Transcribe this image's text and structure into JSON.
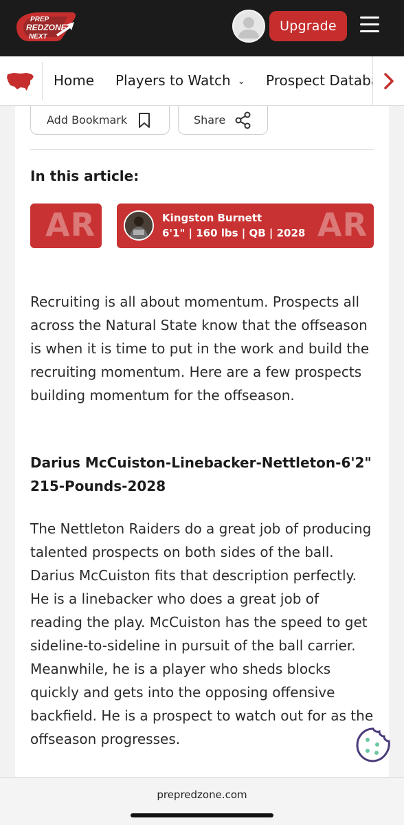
{
  "header": {
    "logo_text": [
      "PREP",
      "REDZONE",
      "NEXT"
    ],
    "upgrade_label": "Upgrade",
    "brand_color": "#c62e2e"
  },
  "nav": {
    "items": [
      {
        "label": "Home"
      },
      {
        "label": "Players to Watch",
        "has_dropdown": true
      },
      {
        "label": "Prospect Database"
      }
    ],
    "map_icon": "us-map-icon",
    "next_icon": "chevron-right-icon"
  },
  "actions": {
    "bookmark_label": "Add Bookmark",
    "share_label": "Share"
  },
  "article": {
    "in_article_label": "In this article:",
    "players": [
      {
        "watermark": "AR"
      },
      {
        "name": "Kingston Burnett",
        "meta": "6'1\" | 160 lbs | QB | 2028",
        "watermark": "AR"
      }
    ],
    "intro": "Recruiting is all about momentum. Prospects all across the Natural State know that the offseason is when it is time to put in the work and build the recruiting momentum. Here are a few prospects building momentum for the offseason.",
    "section_heading": "Darius McCuiston-Linebacker-Nettleton-6'2\" 215-Pounds-2028",
    "section_body": "The Nettleton Raiders do a great job of producing talented prospects on both sides of the ball. Darius McCuiston fits that description perfectly. He is a linebacker who does a great job of reading the play. McCuiston has the speed to get sideline-to-sideline in pursuit of the ball carrier. Meanwhile, he is a player who sheds blocks quickly and gets into the opposing offensive backfield. He is a prospect to watch out for as the offseason progresses."
  },
  "footer": {
    "domain": "prepredzone.com"
  }
}
